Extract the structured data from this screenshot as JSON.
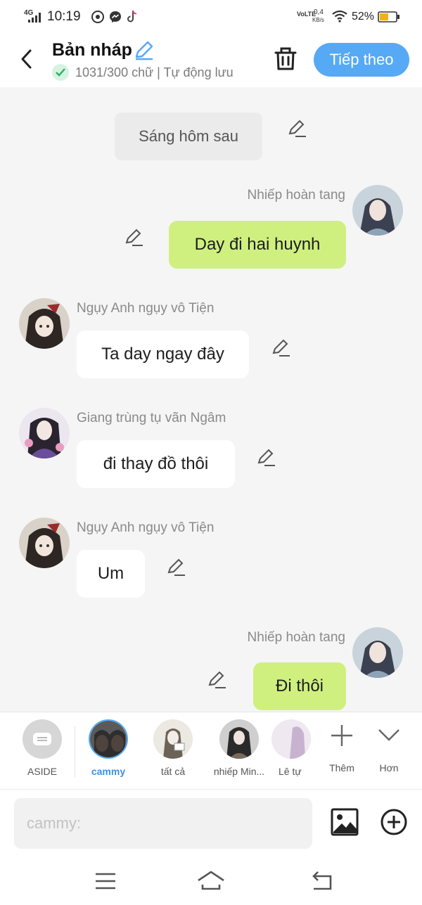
{
  "status_bar": {
    "network": "4G",
    "time": "10:19",
    "volte": "VoLTE",
    "speed_value": "0,4",
    "speed_unit": "KB/s",
    "battery": "52%"
  },
  "header": {
    "title": "Bản nháp",
    "subtitle": "1031/300 chữ | Tự động lưu",
    "next_label": "Tiếp theo",
    "accent_color": "#56a9f5"
  },
  "chat": {
    "aside": "Sáng hôm sau",
    "messages": [
      {
        "side": "right",
        "name": "Nhiếp hoàn tang",
        "text": "Day đi hai huynh"
      },
      {
        "side": "left",
        "name": "Ngụy Anh ngụy vô Tiện",
        "text": "Ta day ngay đây"
      },
      {
        "side": "left",
        "name": "Giang trùng tụ vãn Ngâm",
        "text": "đi thay đồ thôi"
      },
      {
        "side": "left",
        "name": "Ngụy Anh ngụy vô Tiện",
        "text": "Um"
      },
      {
        "side": "right",
        "name": "Nhiếp hoàn tang",
        "text": "Đi thôi"
      }
    ],
    "right_bubble_color": "#cff07f"
  },
  "characters": {
    "items": [
      {
        "label": "ASIDE"
      },
      {
        "label": "cammy"
      },
      {
        "label": "tất cả"
      },
      {
        "label": "nhiếp Min..."
      },
      {
        "label": "Lê tự"
      }
    ],
    "add_label": "Thêm",
    "more_label": "Hơn"
  },
  "input": {
    "placeholder": "cammy:"
  }
}
